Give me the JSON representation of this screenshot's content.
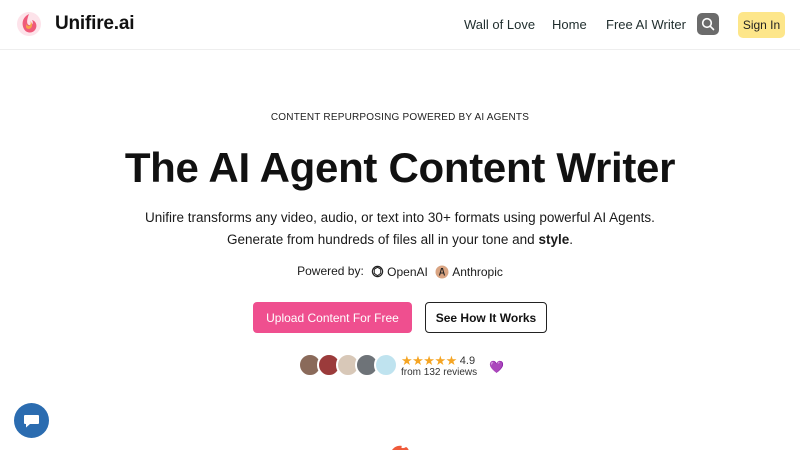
{
  "header": {
    "brand": "Unifire.ai",
    "nav": [
      {
        "label": "Wall of Love"
      },
      {
        "label": "Home"
      },
      {
        "label": "Free AI Writer"
      }
    ],
    "search_icon": "search-icon",
    "signin_label": "Sign In"
  },
  "hero": {
    "kicker": "CONTENT REPURPOSING POWERED BY AI AGENTS",
    "title": "The AI Agent Content Writer",
    "subtitle_line1": "Unifire transforms any video, audio, or text into 30+ formats using powerful AI Agents.",
    "subtitle_line2_prefix": "Generate from hundreds of files all in your tone and ",
    "subtitle_line2_bold": "style",
    "subtitle_line2_suffix": ".",
    "powered_label": "Powered by:",
    "providers": [
      {
        "name": "OpenAI",
        "icon": "openai-icon"
      },
      {
        "name": "Anthropic",
        "icon": "anthropic-icon"
      }
    ],
    "primary_cta": "Upload Content For Free",
    "secondary_cta": "See How It Works",
    "rating": {
      "stars": "★★★★★",
      "score": "4.9",
      "reviews": "from 132 reviews",
      "heart": "💜"
    }
  },
  "colors": {
    "primary": "#ef4f8f",
    "signin_bg": "#fde68a",
    "chat_bg": "#2b6cb0",
    "star": "#f5a524"
  },
  "chat_icon": "chat-bubble-icon"
}
